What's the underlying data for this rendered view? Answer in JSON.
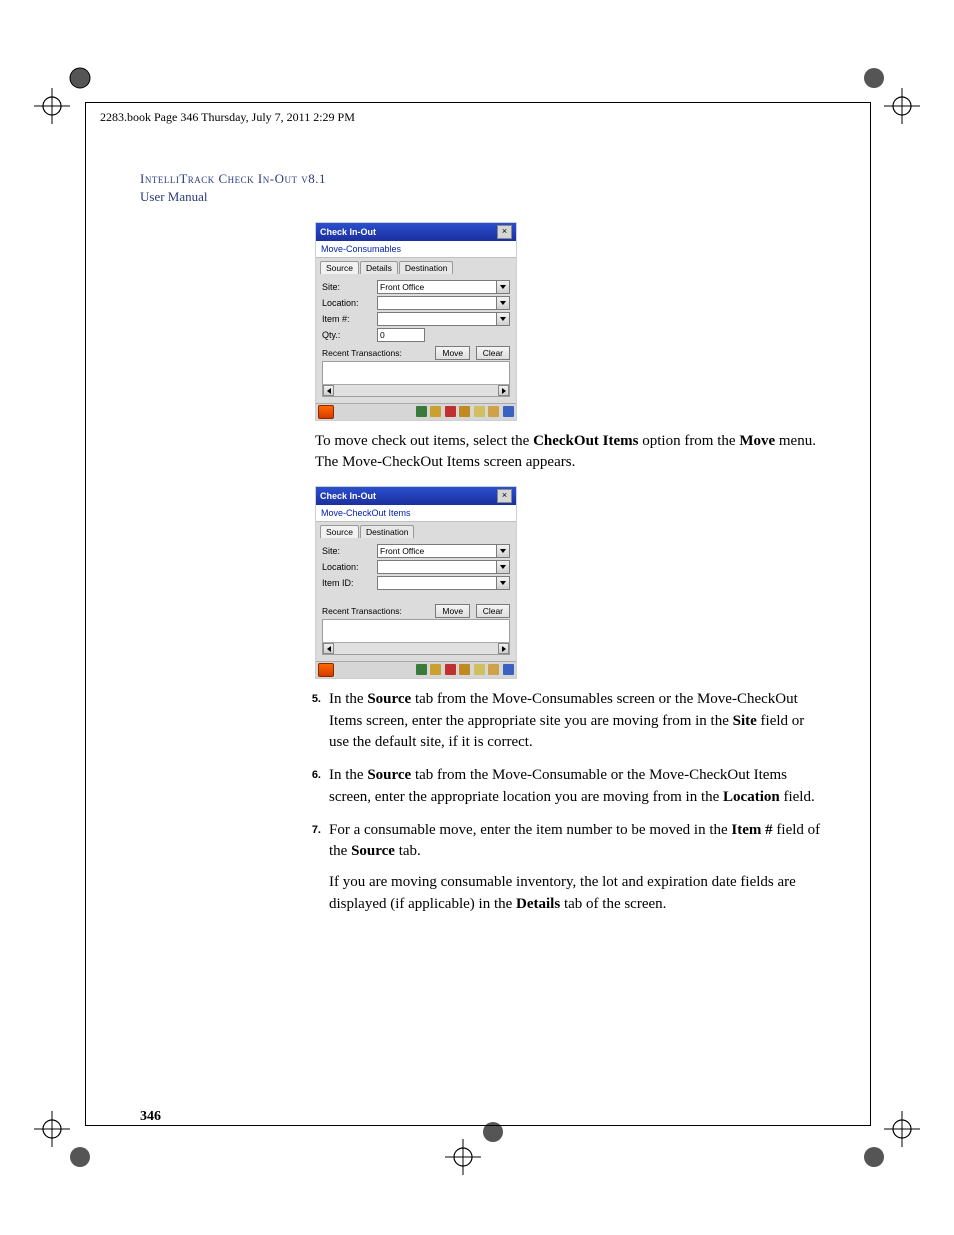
{
  "running_head": "2283.book  Page 346  Thursday, July 7, 2011  2:29 PM",
  "header": {
    "product": "IntelliTrack Check In-Out v8.1",
    "subtitle": "User Manual"
  },
  "screenshot1": {
    "title": "Check In-Out",
    "subtitle": "Move-Consumables",
    "tabs": [
      "Source",
      "Details",
      "Destination"
    ],
    "active_tab": 0,
    "fields": {
      "site_label": "Site:",
      "site_value": "Front Office",
      "location_label": "Location:",
      "location_value": "",
      "item_label": "Item #:",
      "item_value": "",
      "qty_label": "Qty.:",
      "qty_value": "0"
    },
    "recent_label": "Recent Transactions:",
    "move_btn": "Move",
    "clear_btn": "Clear"
  },
  "para1_pre": "To move check out items, select the ",
  "para1_b1": "CheckOut Items",
  "para1_mid": " option from the ",
  "para1_b2": "Move",
  "para1_post": " menu. The Move-CheckOut Items screen appears.",
  "screenshot2": {
    "title": "Check In-Out",
    "subtitle": "Move-CheckOut Items",
    "tabs": [
      "Source",
      "Destination"
    ],
    "active_tab": 0,
    "fields": {
      "site_label": "Site:",
      "site_value": "Front Office",
      "location_label": "Location:",
      "location_value": "",
      "item_label": "Item ID:",
      "item_value": ""
    },
    "recent_label": "Recent Transactions:",
    "move_btn": "Move",
    "clear_btn": "Clear"
  },
  "steps": {
    "s5": {
      "num": "5.",
      "t1": "In the ",
      "b1": "Source",
      "t2": " tab from the Move-Consumables screen or the Move-CheckOut Items screen, enter the appropriate site you are moving from in the ",
      "b2": "Site",
      "t3": " field or use the default site, if it is correct."
    },
    "s6": {
      "num": "6.",
      "t1": "In the ",
      "b1": "Source",
      "t2": " tab from the Move-Consumable or the Move-CheckOut Items screen, enter the appropriate location you are moving from in the ",
      "b2": "Location",
      "t3": " field."
    },
    "s7": {
      "num": "7.",
      "t1": "For a consumable move, enter the item number to be moved in the ",
      "b1": "Item #",
      "t2": " field of the ",
      "b2": "Source",
      "t3": " tab.",
      "p2a": "If you are moving consumable inventory, the lot and expiration date fields are displayed (if applicable) in the ",
      "p2b": "Details",
      "p2c": " tab of the screen."
    }
  },
  "page_number": "346"
}
